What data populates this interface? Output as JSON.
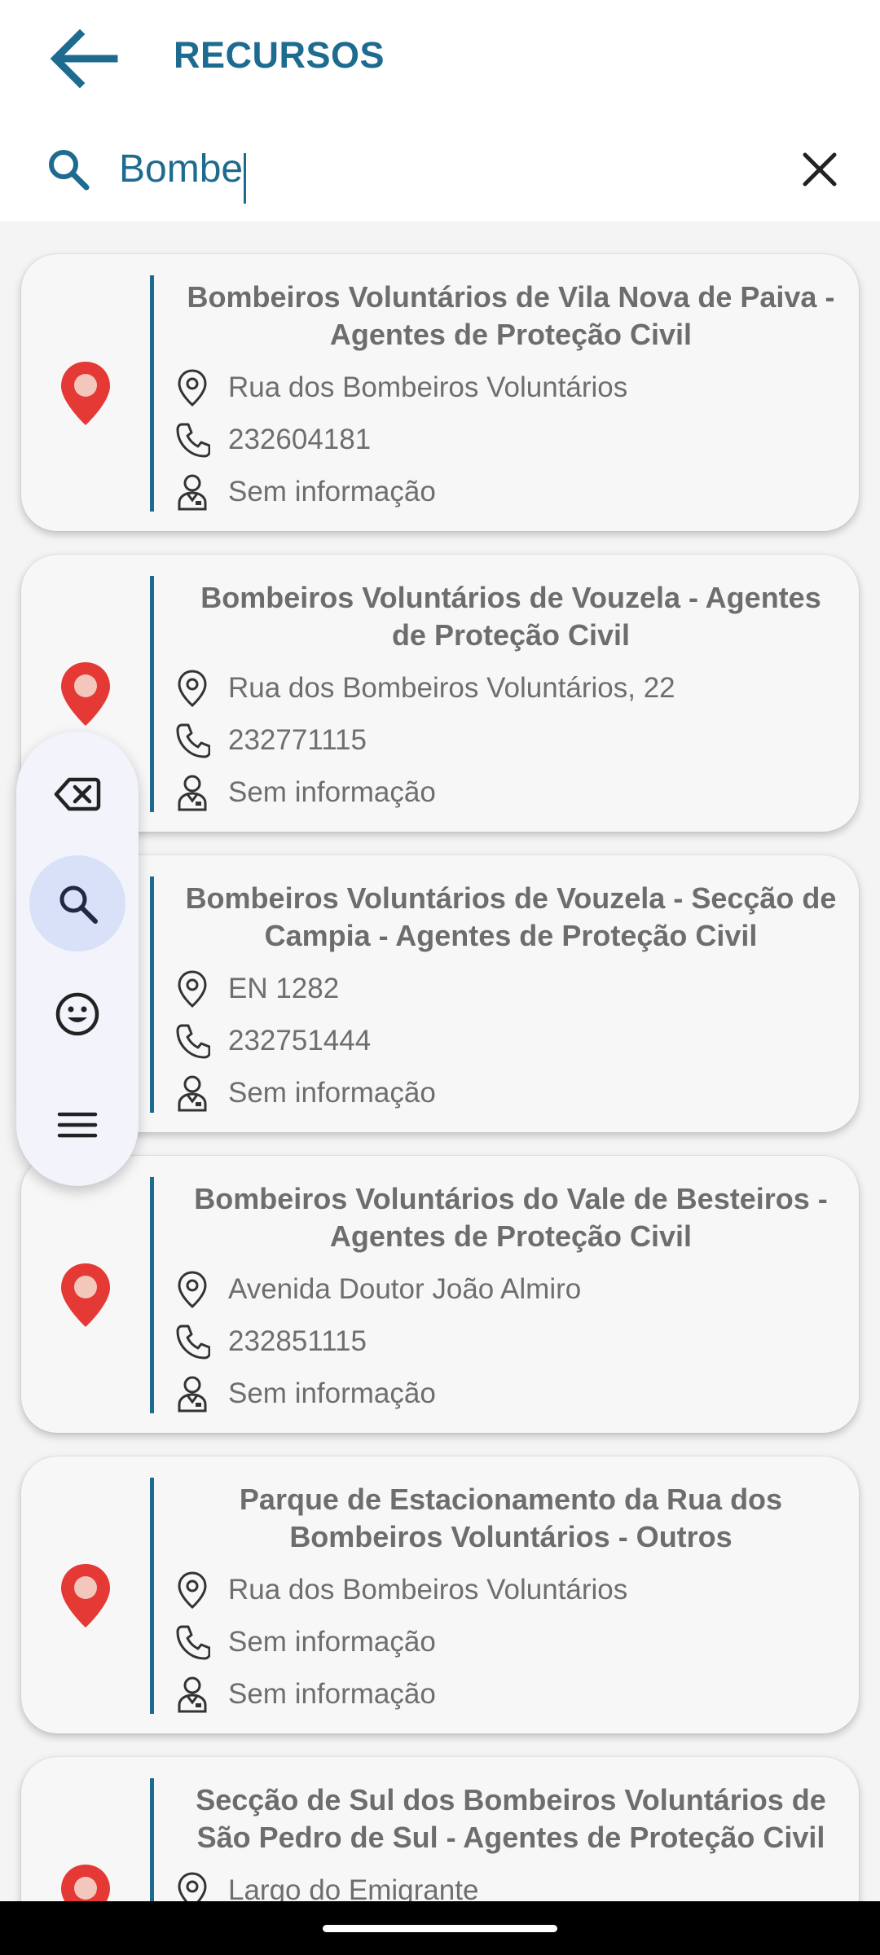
{
  "header": {
    "title": "RECURSOS"
  },
  "search": {
    "value": "Bombe"
  },
  "results": [
    {
      "title": "Bombeiros Voluntários de Vila Nova de Paiva - Agentes de Proteção Civil",
      "address": "Rua dos Bombeiros Voluntários",
      "phone": "232604181",
      "contact": "Sem informação"
    },
    {
      "title": "Bombeiros Voluntários de Vouzela - Agentes de Proteção Civil",
      "address": "Rua dos Bombeiros Voluntários, 22",
      "phone": "232771115",
      "contact": "Sem informação"
    },
    {
      "title": "Bombeiros Voluntários de Vouzela - Secção de Campia - Agentes de Proteção Civil",
      "address": "EN 1282",
      "phone": "232751444",
      "contact": "Sem informação"
    },
    {
      "title": "Bombeiros Voluntários do Vale de Besteiros - Agentes de Proteção Civil",
      "address": "Avenida Doutor João Almiro",
      "phone": "232851115",
      "contact": "Sem informação"
    },
    {
      "title": "Parque de Estacionamento da Rua dos Bombeiros Voluntários - Outros",
      "address": "Rua dos Bombeiros Voluntários",
      "phone": "Sem informação",
      "contact": "Sem informação"
    },
    {
      "title": "Secção de Sul dos Bombeiros Voluntários de São Pedro de Sul - Agentes de Proteção Civil",
      "address": "Largo do Emigrante",
      "phone": "",
      "contact": ""
    }
  ],
  "keyboard_toolbar": {
    "buttons": [
      "backspace-icon",
      "search-icon",
      "emoji-icon",
      "menu-icon"
    ],
    "active": "search-icon"
  },
  "colors": {
    "accent": "#1d6b8f",
    "pin": "#e53935",
    "text_gray": "#6e6e6e",
    "toolbar_active": "#d8e1f8"
  }
}
